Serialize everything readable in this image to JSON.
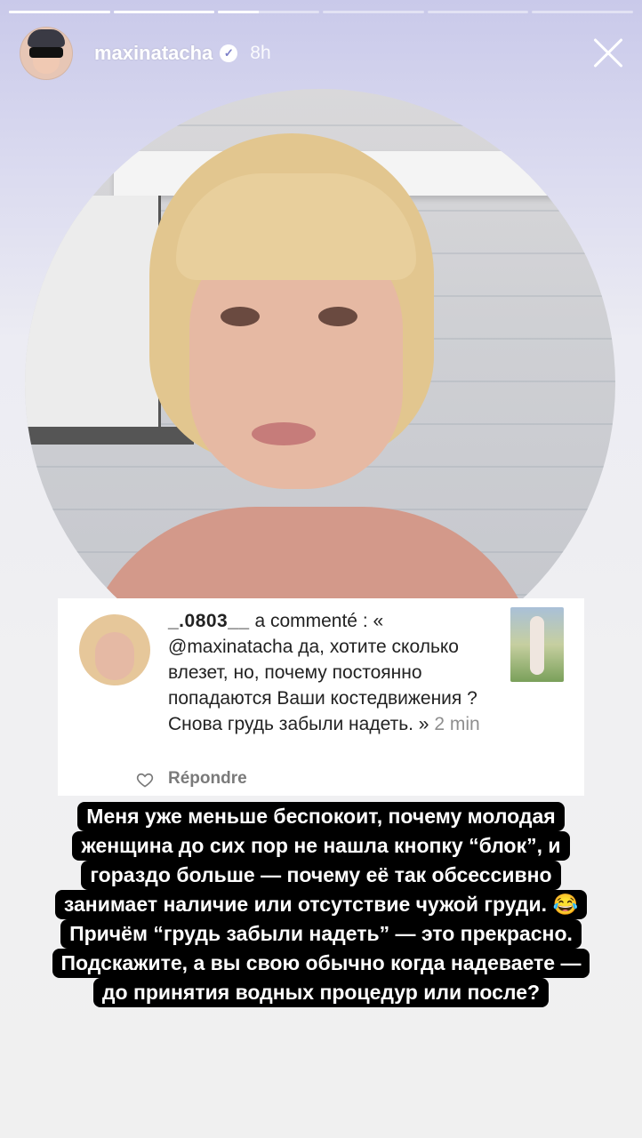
{
  "story": {
    "segments": 6,
    "active_index": 2,
    "active_progress": 0.4
  },
  "header": {
    "username": "maxinatacha",
    "verified_glyph": "✓",
    "time": "8h",
    "close_icon": "close-icon"
  },
  "comment": {
    "username": "_.0803__",
    "action": "a commenté :",
    "text": "« @maxinatacha да, хотите сколько влезет, но, почему постоянно попадаются Ваши костедвижения ? Снова грудь забыли надеть. »",
    "time": "2 min",
    "reply_label": "Répondre"
  },
  "caption": {
    "lines": [
      "Меня уже меньше беспокоит, почему молодая",
      "женщина до сих пор не нашла кнопку “блок”, и",
      "гораздо больше — почему её так обсессивно",
      "занимает наличие или отсутствие чужой груди. 😂",
      "Причём “грудь забыли надеть” — это прекрасно.",
      "Подскажите, а вы свою обычно когда надеваете —",
      "до принятия водных процедур или после?"
    ]
  }
}
